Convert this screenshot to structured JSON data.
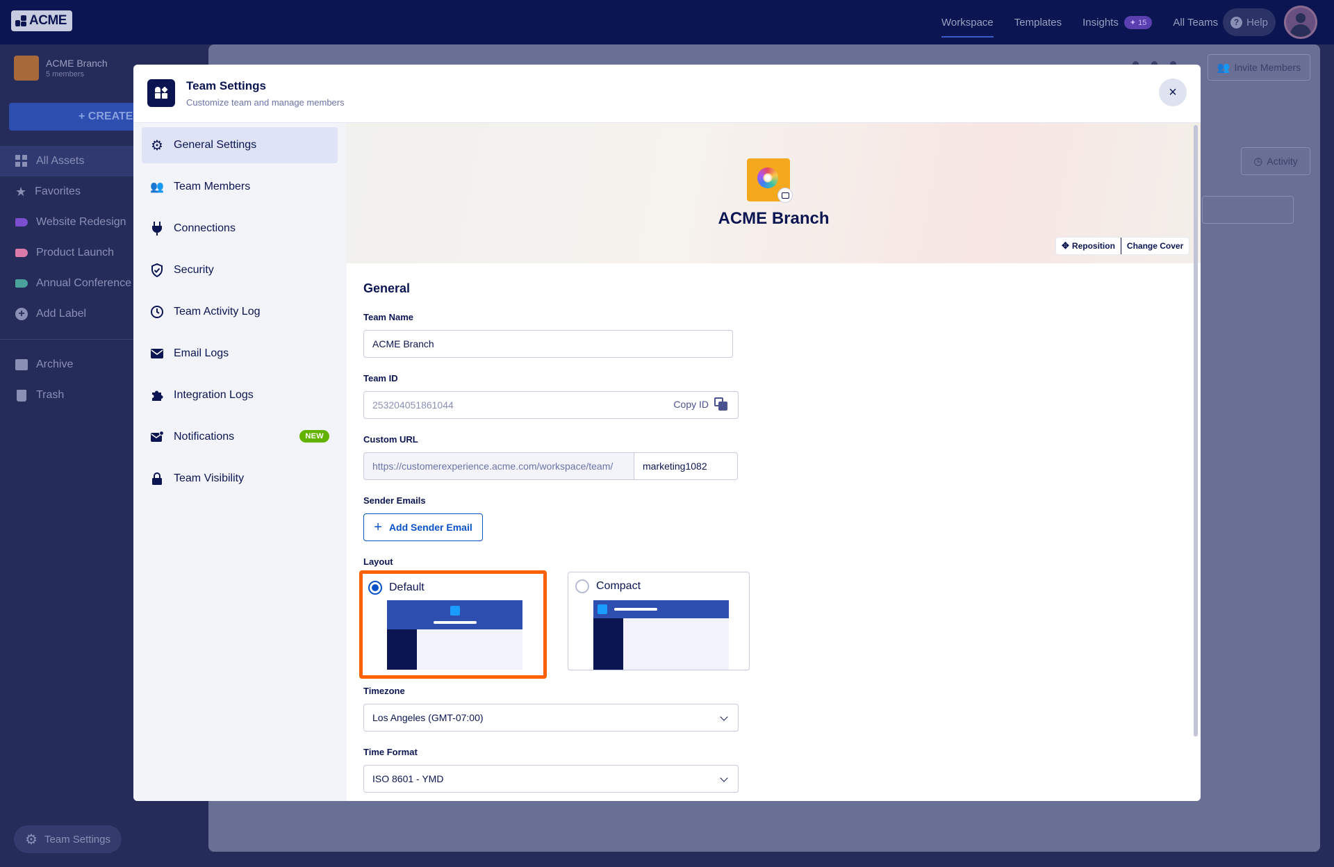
{
  "topbar": {
    "logo": "ACME",
    "nav": [
      "Workspace",
      "Templates",
      "Insights",
      "All Teams"
    ],
    "insights_badge": "15",
    "help": "Help"
  },
  "sidebar": {
    "team_name": "ACME Branch",
    "team_members": "5 members",
    "create": "+ CREATE",
    "items": [
      {
        "label": "All Assets"
      },
      {
        "label": "Favorites"
      },
      {
        "label": "Website Redesign",
        "color": "#7b4fd0"
      },
      {
        "label": "Product Launch",
        "color": "#d97aa8"
      },
      {
        "label": "Annual Conference",
        "color": "#4aa39a"
      },
      {
        "label": "Add Label"
      },
      {
        "label": "Archive"
      },
      {
        "label": "Trash"
      }
    ],
    "team_settings": "Team Settings"
  },
  "background": {
    "invite_members": "Invite Members",
    "activity": "Activity"
  },
  "modal": {
    "title": "Team Settings",
    "subtitle": "Customize team and manage members",
    "close": "×",
    "nav": [
      {
        "label": "General Settings",
        "icon": "gear-icon"
      },
      {
        "label": "Team Members",
        "icon": "users-icon"
      },
      {
        "label": "Connections",
        "icon": "plug-icon"
      },
      {
        "label": "Security",
        "icon": "shield-icon"
      },
      {
        "label": "Team Activity Log",
        "icon": "history-icon"
      },
      {
        "label": "Email Logs",
        "icon": "envelope-icon"
      },
      {
        "label": "Integration Logs",
        "icon": "puzzle-icon"
      },
      {
        "label": "Notifications",
        "icon": "mail-bell-icon",
        "badge": "NEW"
      },
      {
        "label": "Team Visibility",
        "icon": "lock-icon"
      }
    ],
    "cover": {
      "team_name": "ACME Branch",
      "reposition": "Reposition",
      "change_cover": "Change Cover"
    },
    "general": {
      "section_title": "General",
      "team_name_label": "Team Name",
      "team_name_value": "ACME Branch",
      "team_id_label": "Team ID",
      "team_id_value": "253204051861044",
      "copy_id": "Copy ID",
      "custom_url_label": "Custom URL",
      "custom_url_prefix": "https://customerexperience.acme.com/workspace/team/",
      "custom_url_slug": "marketing1082",
      "sender_emails_label": "Sender Emails",
      "add_sender_email": "Add Sender Email",
      "layout_label": "Layout",
      "layout_options": [
        {
          "label": "Default",
          "selected": true
        },
        {
          "label": "Compact",
          "selected": false
        }
      ],
      "timezone_label": "Timezone",
      "timezone_value": "Los Angeles (GMT-07:00)",
      "time_format_label": "Time Format",
      "time_format_value": "ISO 8601 - YMD"
    }
  }
}
